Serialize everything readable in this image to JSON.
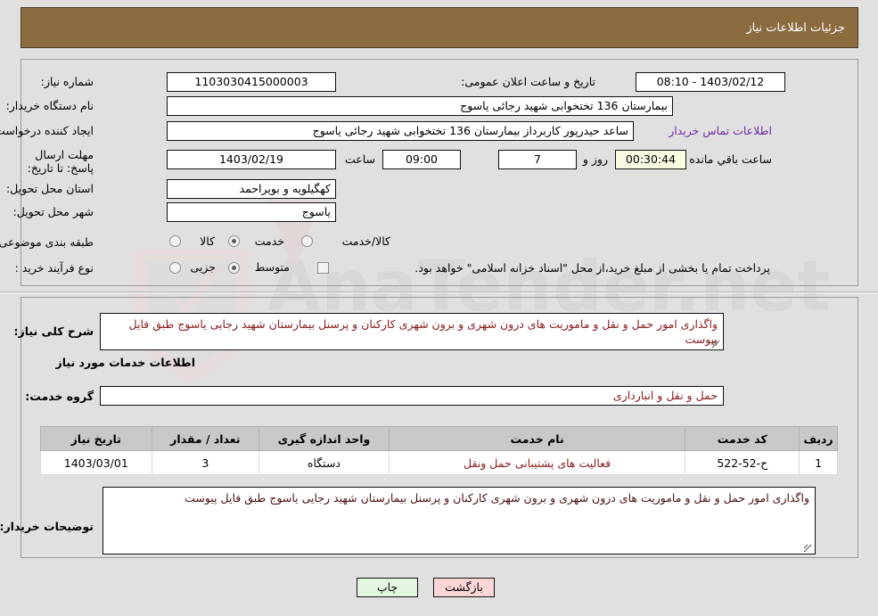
{
  "header": {
    "title": "جزئیات اطلاعات نیاز"
  },
  "form": {
    "need_number_label": "شماره نیاز:",
    "need_number_value": "1103030415000003",
    "announce_label": "تاریخ و ساعت اعلان عمومی:",
    "announce_value": "1403/02/12 - 08:10",
    "buyer_org_label": "نام دستگاه خریدار:",
    "buyer_org_value": "بیمارستان 136 تختخوابی شهید رجائی یاسوج",
    "creator_label": "ایجاد کننده درخواست:",
    "creator_value": "ساعد حیدرپور کاربرداز بیمارستان 136 تختخوابی شهید رجائی یاسوج",
    "contact_link": "اطلاعات تماس خریدار",
    "deadline_label": "مهلت ارسال پاسخ: تا تاریخ:",
    "deadline_date": "1403/02/19",
    "hour_label": "ساعت",
    "deadline_time": "09:00",
    "days_value": "7",
    "days_label": "روز و",
    "remaining_time": "00:30:44",
    "remaining_label": "ساعت باقي مانده",
    "province_label": "استان محل تحویل:",
    "province_value": "کهگیلویه و بویراحمد",
    "city_label": "شهر محل تحویل:",
    "city_value": "یاسوج",
    "category_label": "طبقه بندی موضوعی:",
    "category_options": [
      "کالا",
      "خدمت",
      "کالا/خدمت"
    ],
    "category_selected": "خدمت",
    "process_label": "نوع فرآیند خرید :",
    "process_options": [
      "جزیی",
      "متوسط"
    ],
    "process_selected": "متوسط",
    "treasury_note": "پرداخت تمام یا بخشی از مبلغ خرید،از محل \"اسناد خزانه اسلامی\" خواهد بود."
  },
  "description": {
    "general_label": "شرح کلی نیاز:",
    "general_value": "واگذاری امور حمل و نقل و ماموریت های درون شهری و برون شهری کارکنان و پرسنل بیمارستان شهید رجایی یاسوج طبق فایل پیوست",
    "services_heading": "اطلاعات خدمات مورد نیاز",
    "service_group_label": "گروه خدمت:",
    "service_group_value": "حمل و نقل و انبارداری",
    "buyer_notes_label": "توضیحات خریدار:",
    "buyer_notes_value": "واگذاری امور حمل و نقل و ماموریت های درون شهری و برون شهری کارکنان و پرسنل بیمارستان شهید رجایی یاسوج طبق فایل پیوست"
  },
  "table": {
    "columns": [
      "ردیف",
      "کد خدمت",
      "نام خدمت",
      "واحد اندازه گیری",
      "تعداد / مقدار",
      "تاریخ نیاز"
    ],
    "rows": [
      {
        "row": "1",
        "code": "ح-52-522",
        "name": "فعالیت های پشتیبانی حمل ونقل",
        "unit": "دستگاه",
        "qty": "3",
        "date": "1403/03/01"
      }
    ]
  },
  "footer": {
    "back_label": "بازگشت",
    "print_label": "چاپ"
  },
  "watermark": {
    "text": "AnaTender.net"
  },
  "colors": {
    "header_bg": "#8c6b3f",
    "link": "#6f2da8",
    "value_text": "#8b1a1a",
    "back_btn": "#fcd6d6",
    "print_btn": "#e3f7e0",
    "page_bg": "#e0e0e0"
  }
}
